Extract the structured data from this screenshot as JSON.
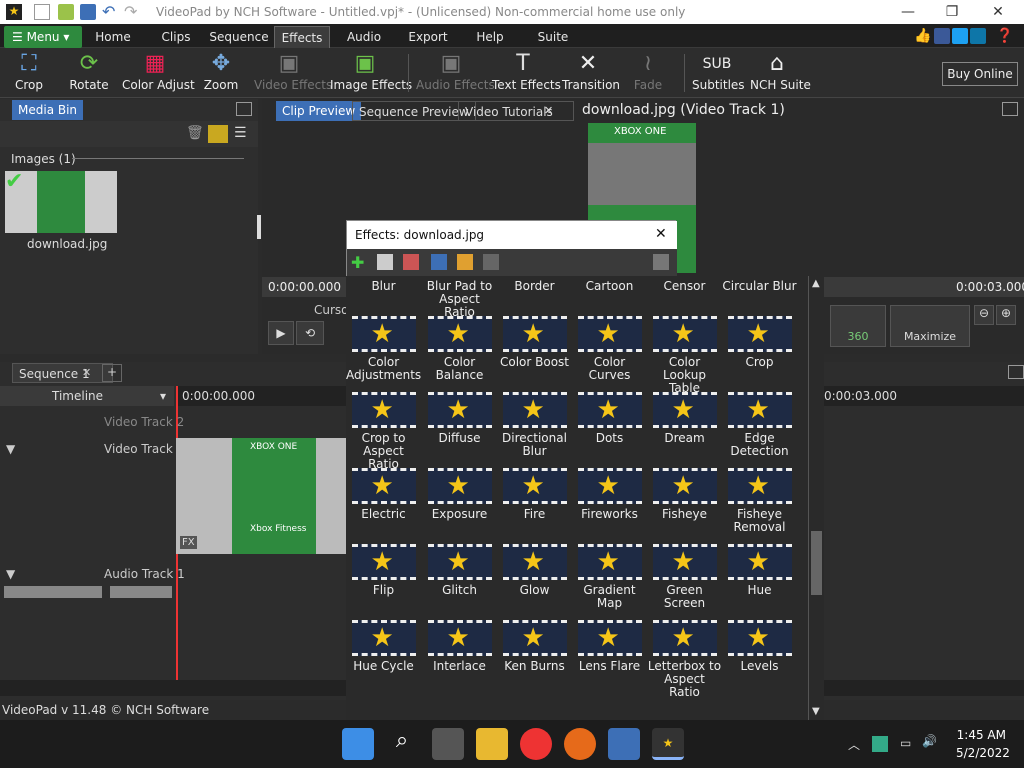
{
  "window": {
    "title": "VideoPad by NCH Software - Untitled.vpj* - (Unlicensed) Non-commercial home use only"
  },
  "menubar": {
    "menu_label": "Menu",
    "tabs": [
      "Home",
      "Clips",
      "Sequence",
      "Effects",
      "Audio",
      "Export",
      "Help",
      "Suite"
    ],
    "active_tab": "Effects"
  },
  "toolbar": {
    "items": [
      {
        "label": "Crop",
        "icon": "crop-icon",
        "enabled": true
      },
      {
        "label": "Rotate",
        "icon": "rotate-icon",
        "enabled": true
      },
      {
        "label": "Color Adjust",
        "icon": "color-adjust-icon",
        "enabled": true
      },
      {
        "label": "Zoom",
        "icon": "zoom-icon",
        "enabled": true
      },
      {
        "label": "Video Effects",
        "icon": "video-effects-icon",
        "enabled": false
      },
      {
        "label": "Image Effects",
        "icon": "image-effects-icon",
        "enabled": true
      },
      {
        "label": "Audio Effects",
        "icon": "audio-effects-icon",
        "enabled": false
      },
      {
        "label": "Text Effects",
        "icon": "text-effects-icon",
        "enabled": true
      },
      {
        "label": "Transition",
        "icon": "transition-icon",
        "enabled": true
      },
      {
        "label": "Fade",
        "icon": "fade-icon",
        "enabled": false
      },
      {
        "label": "Subtitles",
        "icon": "subtitles-icon",
        "enabled": true
      },
      {
        "label": "NCH Suite",
        "icon": "nch-suite-icon",
        "enabled": true
      }
    ],
    "buy_online": "Buy Online"
  },
  "media_bin": {
    "tab": "Media Bin",
    "section": "Images (1)",
    "item": "download.jpg"
  },
  "preview": {
    "tabs": [
      "Clip Preview",
      "Sequence Preview",
      "Video Tutorials"
    ],
    "active_tab": "Clip Preview",
    "title": "download.jpg (Video Track 1)",
    "time_start": "0:00:00.000",
    "time_end": "0:00:03.000",
    "cursor_label": "Cursor",
    "maximize": "Maximize",
    "badge_360": "360",
    "thumb_brand": "XBOX ONE"
  },
  "sequence": {
    "tab": "Sequence 1",
    "timeline_label": "Timeline",
    "ruler_start": "0:00:00.000",
    "ruler_end": "0:00:03.000",
    "tracks": [
      "Video Track 2",
      "Video Track 1",
      "Audio Track 1"
    ],
    "clip_brand": "XBOX ONE",
    "clip_sub": "Xbox Fitness",
    "fx_label": "FX"
  },
  "status": {
    "version": "VideoPad v 11.48 © NCH Software"
  },
  "effects_dialog": {
    "title": "Effects: download.jpg",
    "header_row": [
      "Blur",
      "Blur Pad to Aspect Ratio",
      "Border",
      "Cartoon",
      "Censor",
      "Circular Blur"
    ],
    "rows": [
      [
        "Color Adjustments",
        "Color Balance",
        "Color Boost",
        "Color Curves",
        "Color Lookup Table",
        "Crop"
      ],
      [
        "Crop to Aspect Ratio",
        "Diffuse",
        "Directional Blur",
        "Dots",
        "Dream",
        "Edge Detection"
      ],
      [
        "Electric",
        "Exposure",
        "Fire",
        "Fireworks",
        "Fisheye",
        "Fisheye Removal"
      ],
      [
        "Flip",
        "Glitch",
        "Glow",
        "Gradient Map",
        "Green Screen",
        "Hue"
      ],
      [
        "Hue Cycle",
        "Interlace",
        "Ken Burns",
        "Lens Flare",
        "Letterbox to Aspect Ratio",
        "Levels"
      ]
    ]
  },
  "taskbar": {
    "time": "1:45 AM",
    "date": "5/2/2022",
    "apps": [
      "start-icon",
      "search-icon",
      "task-view-icon",
      "file-explorer-icon",
      "chrome-icon",
      "firefox-icon",
      "remote-desktop-icon",
      "videopad-icon"
    ]
  }
}
